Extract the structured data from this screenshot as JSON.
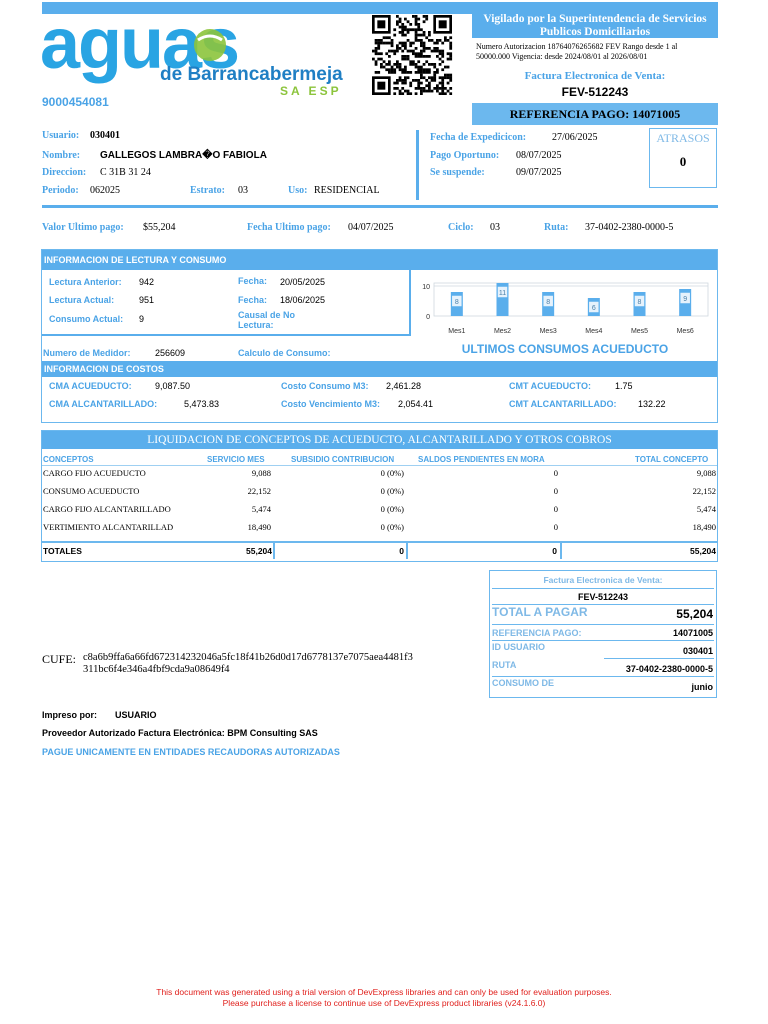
{
  "company": {
    "logo_word": "aguas",
    "logo_sub": "de Barrancabermeja",
    "logo_sub2": "SA ESP",
    "nit": "9000454081"
  },
  "supervision": {
    "title": "Vigilado por la Superintendencia de Servicios Publicos Domiciliarios",
    "authorization": "Numero Autorizacion 18764076265682 FEV Rango desde 1 al 50000.000 Vigencia: desde 2024/08/01 al 2026/08/01",
    "invoice_label": "Factura Electronica de Venta:",
    "invoice_number": "FEV-512243"
  },
  "reference_bar": "REFERENCIA PAGO: 14071005",
  "customer": {
    "usuario_label": "Usuario:",
    "usuario": "030401",
    "nombre_label": "Nombre:",
    "nombre": "GALLEGOS LAMBRA�O FABIOLA",
    "direccion_label": "Direccion:",
    "direccion": "C 31B 31 24",
    "periodo_label": "Periodo:",
    "periodo": "062025",
    "estrato_label": "Estrato:",
    "estrato": "03",
    "uso_label": "Uso:",
    "uso": "RESIDENCIAL"
  },
  "dates": {
    "expedicion_label": "Fecha de Expedicicon:",
    "expedicion": "27/06/2025",
    "oportuno_label": "Pago Oportuno:",
    "oportuno": "08/07/2025",
    "suspende_label": "Se suspende:",
    "suspende": "09/07/2025"
  },
  "atrasos": {
    "label": "ATRASOS",
    "value": "0"
  },
  "last_payment": {
    "valor_label": "Valor Ultimo pago:",
    "valor": "$55,204",
    "fecha_label": "Fecha Ultimo pago:",
    "fecha": "04/07/2025",
    "ciclo_label": "Ciclo:",
    "ciclo": "03",
    "ruta_label": "Ruta:",
    "ruta": "37-0402-2380-0000-5"
  },
  "reading": {
    "header": "INFORMACION DE LECTURA Y CONSUMO",
    "anterior_label": "Lectura Anterior:",
    "anterior": "942",
    "actual_label": "Lectura Actual:",
    "actual": "951",
    "consumo_label": "Consumo Actual:",
    "consumo": "9",
    "fecha1_label": "Fecha:",
    "fecha1": "20/05/2025",
    "fecha2_label": "Fecha:",
    "fecha2": "18/06/2025",
    "causal_label": "Causal de No Lectura:",
    "medidor_label": "Numero de Medidor:",
    "medidor": "256609",
    "calculo_label": "Calculo de Consumo:"
  },
  "chart_data": {
    "type": "bar",
    "categories": [
      "Mes1",
      "Mes2",
      "Mes3",
      "Mes4",
      "Mes5",
      "Mes6"
    ],
    "values": [
      8,
      11,
      8,
      6,
      8,
      9
    ],
    "ylim": [
      0,
      11
    ],
    "yticks": [
      "0",
      "10"
    ],
    "caption": "ULTIMOS CONSUMOS ACUEDUCTO",
    "color": "#5aaeec",
    "grid": true
  },
  "costs": {
    "header": "INFORMACION DE COSTOS",
    "cma_acu_label": "CMA ACUEDUCTO:",
    "cma_acu": "9,087.50",
    "cma_alc_label": "CMA ALCANTARILLADO:",
    "cma_alc": "5,473.83",
    "costo_m3_label": "Costo Consumo M3:",
    "costo_m3": "2,461.28",
    "costo_venc_label": "Costo Vencimiento M3:",
    "costo_venc": "2,054.41",
    "cmt_acu_label": "CMT ACUEDUCTO:",
    "cmt_acu": "1.75",
    "cmt_alc_label": "CMT ALCANTARILLADO:",
    "cmt_alc": "132.22"
  },
  "liquidation": {
    "title": "LIQUIDACION DE CONCEPTOS DE ACUEDUCTO, ALCANTARILLADO Y OTROS COBROS",
    "columns": [
      "CONCEPTOS",
      "SERVICIO MES",
      "SUBSIDIO CONTRIBUCION",
      "SALDOS PENDIENTES EN MORA",
      "TOTAL CONCEPTO"
    ],
    "rows": [
      [
        "CARGO FIJO ACUEDUCTO",
        "9,088",
        "0 (0%)",
        "0",
        "9,088"
      ],
      [
        "CONSUMO ACUEDUCTO",
        "22,152",
        "0 (0%)",
        "0",
        "22,152"
      ],
      [
        "CARGO FIJO ALCANTARILLADO",
        "5,474",
        "0 (0%)",
        "0",
        "5,474"
      ],
      [
        "VERTIMIENTO ALCANTARILLAD",
        "18,490",
        "0 (0%)",
        "0",
        "18,490"
      ]
    ],
    "totals": [
      "TOTALES",
      "55,204",
      "0",
      "0",
      "55,204"
    ]
  },
  "summary": {
    "invoice_label": "Factura Electronica de Venta:",
    "invoice_number": "FEV-512243",
    "total_label": "TOTAL A PAGAR",
    "total": "55,204",
    "ref_label": "REFERENCIA PAGO:",
    "ref": "14071005",
    "id_label": "ID USUARIO",
    "id": "030401",
    "ruta_label": "RUTA",
    "ruta": "37-0402-2380-0000-5",
    "consumo_label": "CONSUMO DE",
    "consumo": "junio"
  },
  "cufe": {
    "label": "CUFE:",
    "line1": "c8a6b9ffa6a66fd672314232046a5fc18f41b26d0d17d6778137e7075aea4481f3",
    "line2": "311bc6f4e346a4fbf9cda9a08649f4"
  },
  "footer": {
    "impreso_label": "Impreso por:",
    "impreso": "USUARIO",
    "proveedor": "Proveedor Autorizado Factura Electrónica: BPM Consulting SAS",
    "pague": "PAGUE UNICAMENTE EN ENTIDADES RECAUDORAS AUTORIZADAS",
    "trial1": "This document was generated using a trial version of DevExpress libraries and can only be used for evaluation purposes.",
    "trial2": "Please purchase a license to continue use of DevExpress product libraries (v24.1.6.0)"
  },
  "colors": {
    "accent": "#4aa3e6",
    "band": "#5aaeec",
    "green": "#8cc43c",
    "trial": "#e0201c"
  }
}
